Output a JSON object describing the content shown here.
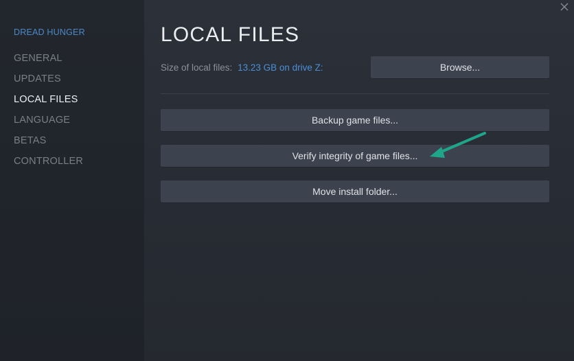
{
  "sidebar": {
    "game_title": "DREAD HUNGER",
    "items": [
      {
        "label": "GENERAL",
        "active": false
      },
      {
        "label": "UPDATES",
        "active": false
      },
      {
        "label": "LOCAL FILES",
        "active": true
      },
      {
        "label": "LANGUAGE",
        "active": false
      },
      {
        "label": "BETAS",
        "active": false
      },
      {
        "label": "CONTROLLER",
        "active": false
      }
    ]
  },
  "main": {
    "title": "LOCAL FILES",
    "size_label": "Size of local files:",
    "size_value": "13.23 GB on drive Z:",
    "browse_label": "Browse...",
    "backup_label": "Backup game files...",
    "verify_label": "Verify integrity of game files...",
    "move_label": "Move install folder..."
  },
  "window": {
    "close_icon": "close-icon"
  },
  "annotation": {
    "icon": "arrow-icon",
    "color": "#1fa68a"
  },
  "colors": {
    "accent_link": "#4a8fd6",
    "game_title": "#4c89c8",
    "button_bg": "#3d434e",
    "sidebar_bg": "#22262d",
    "content_bg": "#2a2e36"
  }
}
